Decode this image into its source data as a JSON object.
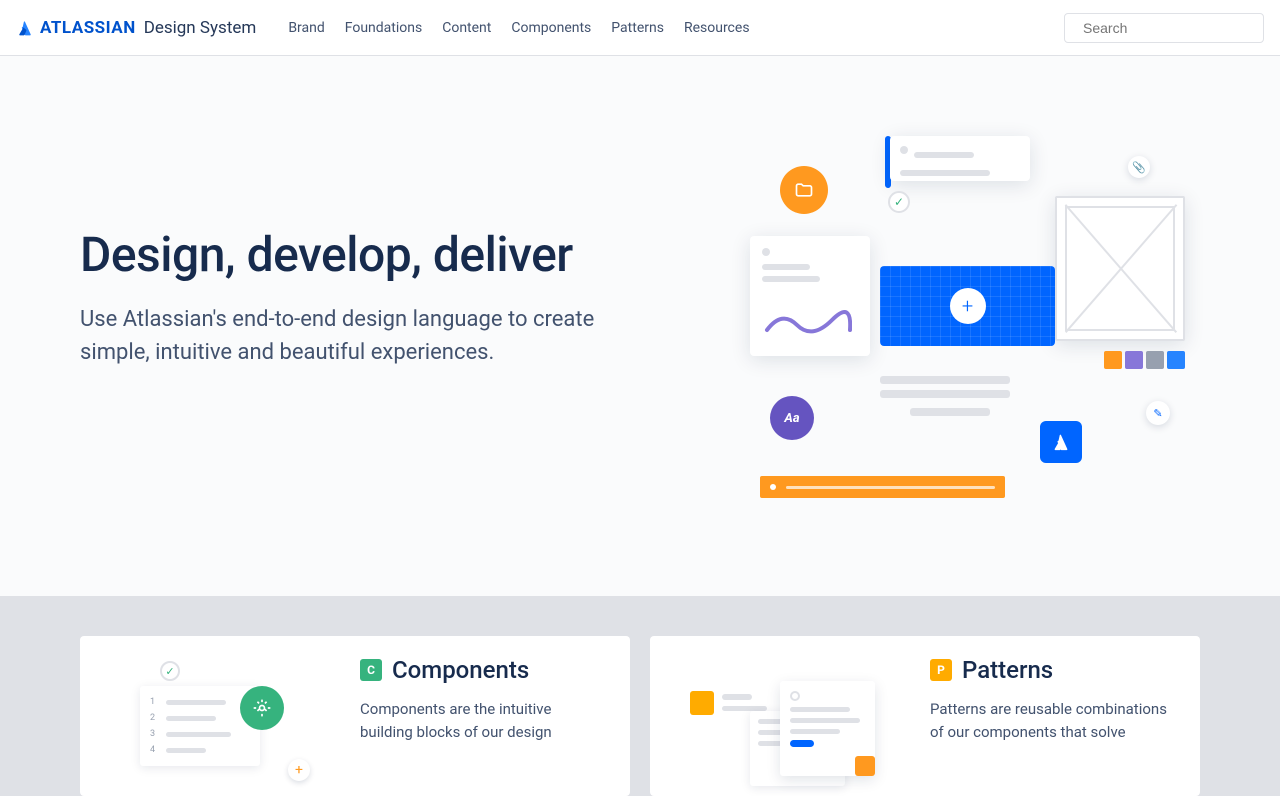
{
  "header": {
    "brand": "ATLASSIAN",
    "brandSub": "Design System",
    "nav": [
      "Brand",
      "Foundations",
      "Content",
      "Components",
      "Patterns",
      "Resources"
    ],
    "searchPlaceholder": "Search"
  },
  "hero": {
    "title": "Design, develop, deliver",
    "subtitle": "Use Atlassian's end-to-end design language to create simple, intuitive and beautiful experiences.",
    "aa": "Aa",
    "swatches": [
      "#FF991F",
      "#8777D9",
      "#97A0AF",
      "#2684FF"
    ]
  },
  "cards": {
    "components": {
      "tag": "C",
      "tagColor": "#36B37E",
      "title": "Components",
      "desc": "Components are the intuitive building blocks of our design"
    },
    "patterns": {
      "tag": "P",
      "tagColor": "#FFAB00",
      "title": "Patterns",
      "desc": "Patterns are reusable combinations of our components that solve"
    }
  }
}
